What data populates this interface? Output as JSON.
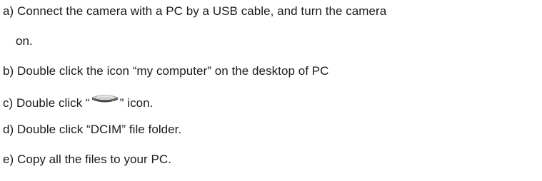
{
  "steps": [
    {
      "text": "a) Connect the camera with a PC by a USB cable, and turn the camera"
    },
    {
      "text": "on."
    },
    {
      "text": "b) Double click the icon “my computer” on the desktop of PC"
    },
    {
      "before": "c) Double click “",
      "icon": "removable-drive-icon",
      "after": "” icon."
    },
    {
      "text": "d) Double click “DCIM” file folder."
    },
    {
      "text": "e) Copy all the files to your PC."
    }
  ]
}
